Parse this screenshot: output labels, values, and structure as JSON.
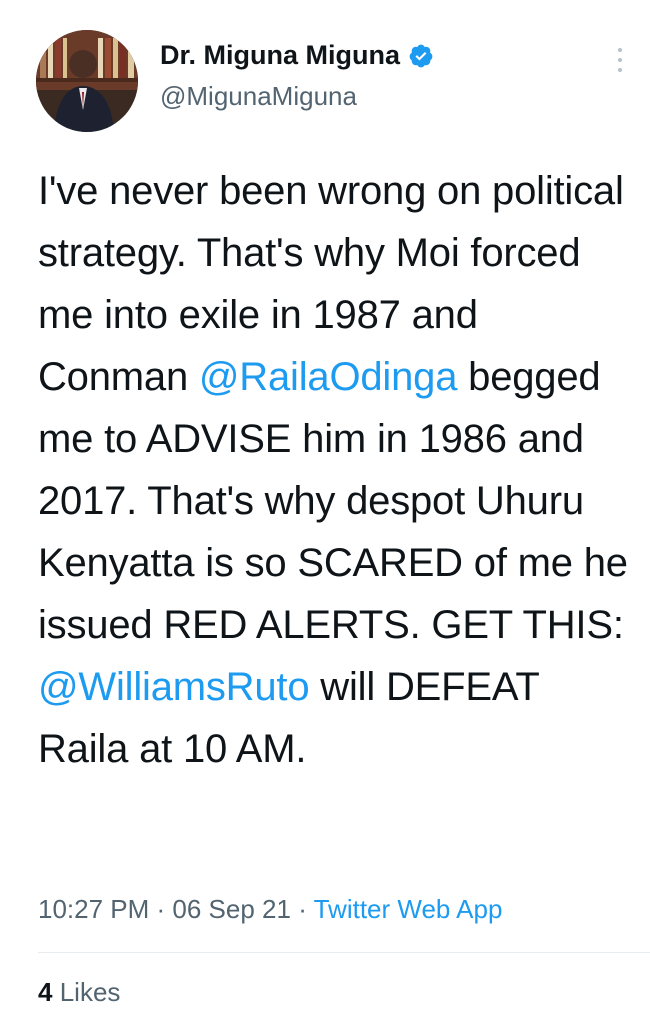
{
  "author": {
    "display_name": "Dr. Miguna Miguna",
    "handle": "@MigunaMiguna",
    "verified": true,
    "avatar_icon": "profile-photo"
  },
  "tweet": {
    "segments": [
      {
        "text": "I've never been wrong on political strategy. That's why Moi forced me into exile in 1987 and Conman ",
        "mention": false
      },
      {
        "text": "@RailaOdinga",
        "mention": true
      },
      {
        "text": " begged me to ADVISE him in 1986 and 2017. That's why despot Uhuru Kenyatta is so SCARED of me he issued RED ALERTS. GET THIS: ",
        "mention": false
      },
      {
        "text": "@WilliamsRuto",
        "mention": true
      },
      {
        "text": " will DEFEAT Raila at 10 AM.",
        "mention": false
      }
    ]
  },
  "meta": {
    "time": "10:27 PM",
    "separator": " · ",
    "date": "06 Sep 21",
    "source": "Twitter Web App"
  },
  "stats": {
    "likes_count": "4",
    "likes_label": "Likes"
  },
  "colors": {
    "link": "#1d9bf0",
    "secondary": "#536471",
    "text": "#0f1419",
    "verified": "#1d9bf0"
  }
}
